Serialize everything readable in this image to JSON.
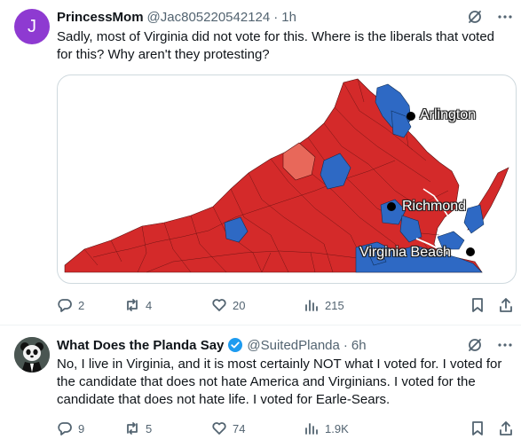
{
  "tweets": [
    {
      "avatar_letter": "J",
      "name": "PrincessMom",
      "handle": "@Jac805220542124",
      "time": "1h",
      "text": "Sadly, most of Virginia did not vote for this.  Where is the liberals that voted for this?  Why aren't they protesting?",
      "media": {
        "labels": [
          "Arlington",
          "Richmond",
          "Virginia Beach"
        ],
        "colors": {
          "republican": "#d42a2a",
          "democrat": "#2e69c4",
          "highlight": "#e8685a"
        }
      },
      "stats": {
        "replies": "2",
        "reposts": "4",
        "likes": "20",
        "views": "215"
      }
    },
    {
      "name": "What Does the Planda Say",
      "handle": "@SuitedPlanda",
      "time": "6h",
      "verified": true,
      "text": "No, I live in Virginia, and it is most certainly NOT what I voted for. I voted for the candidate that does not hate America and Virginians. I voted for the candidate that does not hate life. I voted for Earle-Sears.",
      "stats": {
        "replies": "9",
        "reposts": "5",
        "likes": "74",
        "views": "1.9K"
      }
    }
  ],
  "icons": [
    "grok-icon",
    "more-icon",
    "reply-icon",
    "repost-icon",
    "like-icon",
    "views-icon",
    "bookmark-icon",
    "share-icon",
    "verified-badge-icon"
  ]
}
